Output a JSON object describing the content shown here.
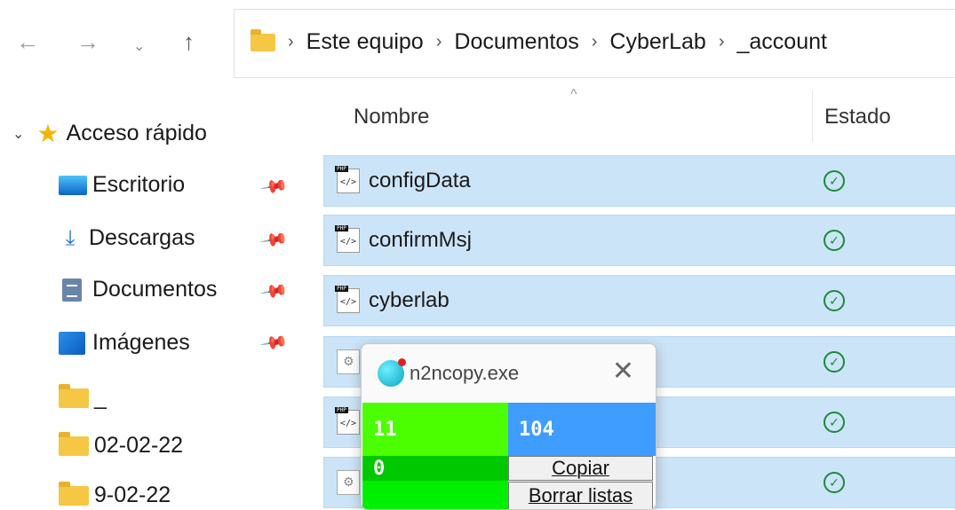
{
  "navigation": {
    "back_glyph": "←",
    "forward_glyph": "→",
    "recent_glyph": "⌄",
    "up_glyph": "↑"
  },
  "address": {
    "crumbs": [
      "Este equipo",
      "Documentos",
      "CyberLab",
      "_account"
    ],
    "separator": "›"
  },
  "sidebar": {
    "quick_access_label": "Acceso rápido",
    "items": [
      {
        "label": "Escritorio",
        "icon": "desktop-icon",
        "pinned": true
      },
      {
        "label": "Descargas",
        "icon": "download-icon",
        "pinned": true
      },
      {
        "label": "Documentos",
        "icon": "document-icon",
        "pinned": true
      },
      {
        "label": "Imágenes",
        "icon": "pictures-icon",
        "pinned": true
      },
      {
        "label": "_",
        "icon": "folder-icon",
        "pinned": false
      },
      {
        "label": "02-02-22",
        "icon": "folder-icon",
        "pinned": false
      },
      {
        "label": "9-02-22",
        "icon": "folder-icon",
        "pinned": false
      }
    ]
  },
  "file_list": {
    "columns": [
      "Nombre",
      "Estado"
    ],
    "sort_caret": "^",
    "rows": [
      {
        "name": "configData",
        "icon": "php-file-icon",
        "status": "synced"
      },
      {
        "name": "confirmMsj",
        "icon": "php-file-icon",
        "status": "synced"
      },
      {
        "name": "cyberlab",
        "icon": "php-file-icon",
        "status": "synced"
      },
      {
        "name": "",
        "icon": "config-file-icon",
        "status": "synced"
      },
      {
        "name": "",
        "icon": "php-file-icon",
        "status": "synced"
      },
      {
        "name": "",
        "icon": "config-file-icon",
        "status": "synced"
      }
    ],
    "status_glyph": "✓"
  },
  "popup": {
    "title": "n2ncopy.exe",
    "close_glyph": "✕",
    "top_left_value": "11",
    "top_right_value": "104",
    "bottom_left_value": "0",
    "copy_button": "Copiar",
    "clear_button": "Borrar listas",
    "colors": {
      "green": "#4cff00",
      "blue": "#3f9dff",
      "dark_green": "#00c800"
    }
  },
  "colors": {
    "row_selected": "#cce4f7",
    "folder": "#f6c744",
    "status_ok": "#1a8a3a"
  }
}
